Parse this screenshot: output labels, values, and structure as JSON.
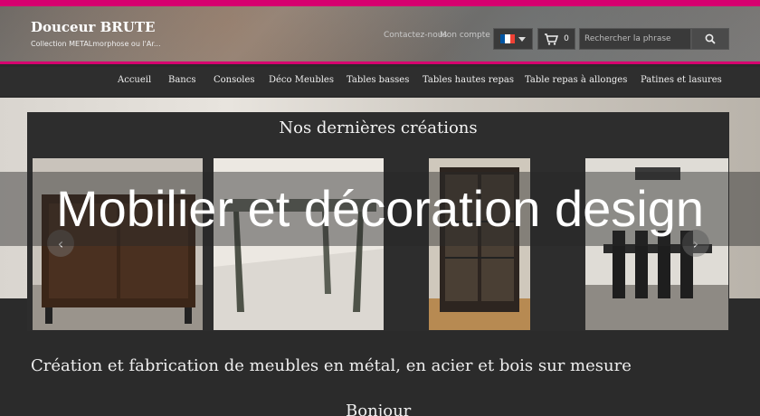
{
  "header": {
    "brand_title": "Douceur BRUTE",
    "brand_subtitle": "Collection METALmorphose ou l'Ar...",
    "links": [
      "Contactez-nous",
      "Mon compte"
    ],
    "cart_count": "0",
    "search_placeholder": "Rechercher la phrase",
    "accent_color": "#d6006f"
  },
  "nav": {
    "items": [
      "Accueil",
      "Bancs",
      "Consoles",
      "Déco Meubles",
      "Tables basses",
      "Tables hautes repas",
      "Table repas à allonges",
      "Patines et lasures"
    ]
  },
  "carousel": {
    "title": "Nos dernières créations",
    "prev_label": "‹",
    "next_label": "›"
  },
  "overlay": {
    "text": "Mobilier et décoration design"
  },
  "main": {
    "tagline": "Création et fabrication de meubles en métal, en acier et bois sur mesure",
    "greeting": "Bonjour"
  }
}
